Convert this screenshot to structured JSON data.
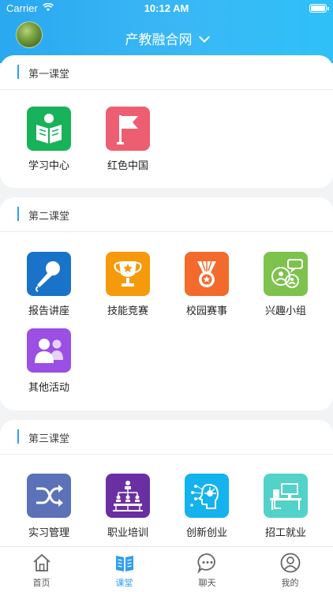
{
  "status_bar": {
    "carrier": "Carrier",
    "time": "10:12 AM"
  },
  "header": {
    "title": "产教融合网"
  },
  "sections": [
    {
      "title": "第一课堂",
      "items": [
        {
          "label": "学习中心",
          "icon": "reading-person-icon",
          "color": "#18b25a"
        },
        {
          "label": "红色中国",
          "icon": "flag-icon",
          "color": "#ee5e73"
        }
      ]
    },
    {
      "title": "第二课堂",
      "items": [
        {
          "label": "报告讲座",
          "icon": "microphone-icon",
          "color": "#1973c9"
        },
        {
          "label": "技能竞赛",
          "icon": "trophy-icon",
          "color": "#f59a0a"
        },
        {
          "label": "校园赛事",
          "icon": "medal-icon",
          "color": "#f26a2c"
        },
        {
          "label": "兴趣小组",
          "icon": "group-chat-icon",
          "color": "#7cc24c"
        },
        {
          "label": "其他活动",
          "icon": "people-icon",
          "color": "#9b4fe3"
        }
      ]
    },
    {
      "title": "第三课堂",
      "items": [
        {
          "label": "实习管理",
          "icon": "shuffle-icon",
          "color": "#5b71b8"
        },
        {
          "label": "职业培训",
          "icon": "org-chart-icon",
          "color": "#6a2fa3"
        },
        {
          "label": "创新创业",
          "icon": "idea-head-icon",
          "color": "#14b2ef"
        },
        {
          "label": "招工就业",
          "icon": "desk-icon",
          "color": "#52d2c8"
        }
      ]
    }
  ],
  "tabbar": [
    {
      "label": "首页",
      "icon": "home-icon"
    },
    {
      "label": "课堂",
      "icon": "book-icon",
      "active": true
    },
    {
      "label": "聊天",
      "icon": "chat-icon"
    },
    {
      "label": "我的",
      "icon": "user-icon"
    }
  ],
  "colors": {
    "accent": "#2f9ef0",
    "header_start": "#2aa8f0",
    "header_end": "#2fc0f8"
  }
}
